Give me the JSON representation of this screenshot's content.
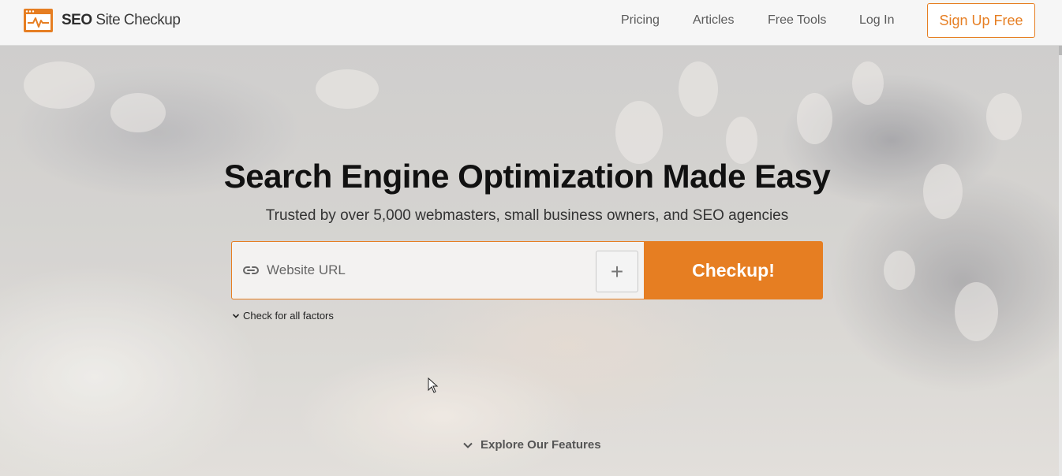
{
  "brand": {
    "name_bold": "SEO",
    "name_rest": " Site Checkup",
    "accent_color": "#e67e22",
    "logo_icon": "pulse-window-icon"
  },
  "nav": {
    "items": [
      {
        "label": "Pricing"
      },
      {
        "label": "Articles"
      },
      {
        "label": "Free Tools"
      },
      {
        "label": "Log In"
      }
    ],
    "signup_label": "Sign Up Free"
  },
  "hero": {
    "title": "Search Engine Optimization Made Easy",
    "subtitle": "Trusted by over 5,000 webmasters, small business owners, and SEO agencies",
    "url_placeholder": "Website URL",
    "url_value": "",
    "plus_label": "+",
    "checkup_label": "Checkup!",
    "factors_label": "Check for all factors",
    "explore_label": "Explore Our Features"
  },
  "icons": {
    "link": "link-icon",
    "chevron": "chevron-down-icon",
    "cursor": "mouse-pointer-icon"
  }
}
